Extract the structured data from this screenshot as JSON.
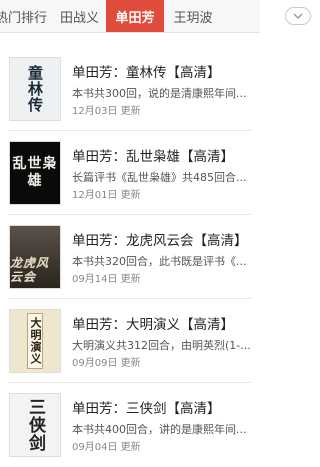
{
  "tabs": [
    {
      "label": "热门排行",
      "active": false
    },
    {
      "label": "田战义",
      "active": false
    },
    {
      "label": "单田芳",
      "active": true
    },
    {
      "label": "王玥波",
      "active": false
    }
  ],
  "more_icon": "chevron-down-icon",
  "accent_color": "#e14b3b",
  "items": [
    {
      "cover_text": "童林传",
      "title": "单田芳：童林传【高清】",
      "desc": "本书共300回，说的是清康熙年间...",
      "date": "12月03日",
      "update": "更新"
    },
    {
      "cover_text": "乱世枭雄",
      "title": "单田芳：乱世枭雄【高清】",
      "desc": "长篇评书《乱世枭雄》共485回合...",
      "date": "12月01日",
      "update": "更新"
    },
    {
      "cover_text": "龙虎风云会",
      "title": "单田芳：龙虎风云会【高清】",
      "desc": "本书共320回合，此书既是评书《...",
      "date": "09月14日",
      "update": "更新"
    },
    {
      "cover_text": "大明演义",
      "title": "单田芳：大明演义【高清】",
      "desc": "大明演义共312回合，由明英烈(1-...",
      "date": "09月09日",
      "update": "更新"
    },
    {
      "cover_text": "三侠剑",
      "title": "单田芳：三侠剑【高清】",
      "desc": "本书共400回合，讲的是康熙年间...",
      "date": "09月04日",
      "update": "更新"
    }
  ]
}
